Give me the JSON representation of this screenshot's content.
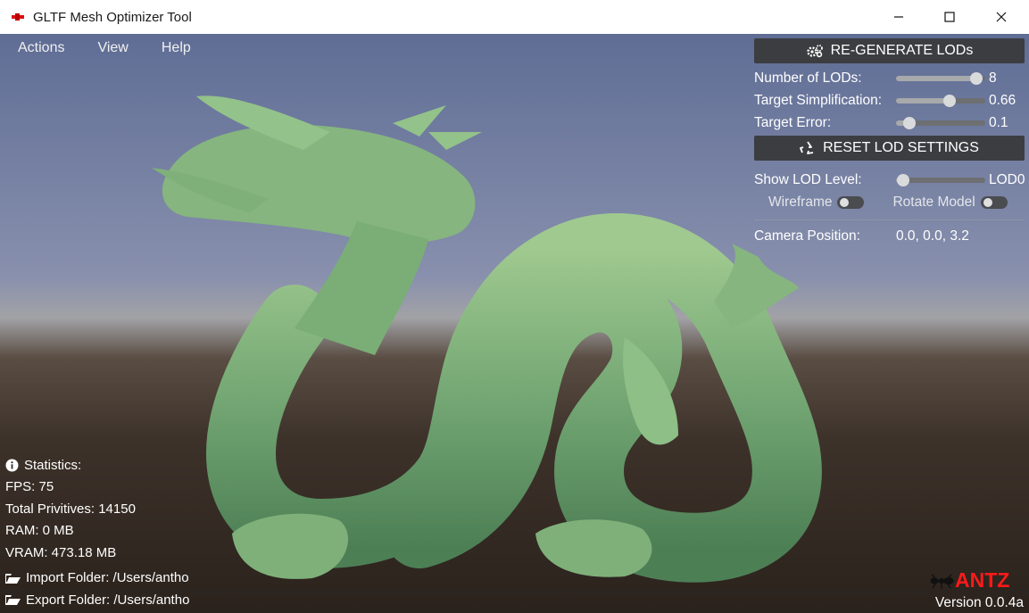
{
  "window": {
    "title": "GLTF Mesh Optimizer Tool",
    "controls": {
      "minimize": "─",
      "maximize": "☐",
      "close": "✕"
    }
  },
  "menu": {
    "items": [
      "Actions",
      "View",
      "Help"
    ]
  },
  "panel": {
    "regenerate_label": "RE-GENERATE LODs",
    "sliders": [
      {
        "label": "Number of LODs:",
        "value": "8",
        "position": 0.9
      },
      {
        "label": "Target Simplification:",
        "value": "0.66",
        "position": 0.6
      },
      {
        "label": "Target Error:",
        "value": "0.1",
        "position": 0.15
      }
    ],
    "reset_label": "RESET LOD SETTINGS",
    "lod_level": {
      "label": "Show LOD Level:",
      "value": "LOD0",
      "position": 0.08
    },
    "wireframe_label": "Wireframe",
    "rotate_label": "Rotate Model",
    "camera": {
      "label": "Camera Position:",
      "value": "0.0, 0.0, 3.2"
    }
  },
  "stats": {
    "title": "Statistics:",
    "fps": "FPS: 75",
    "primitives": "Total Privitives: 14150",
    "ram": "RAM: 0 MB",
    "vram": "VRAM: 473.18 MB",
    "import_folder": "Import Folder: /Users/antho",
    "export_folder": "Export Folder: /Users/antho"
  },
  "brand": {
    "logo": "ANTZ",
    "version": "Version 0.0.4a"
  },
  "colors": {
    "accent_red": "#ff1a1a",
    "dragon_green": "#7fb07a"
  }
}
